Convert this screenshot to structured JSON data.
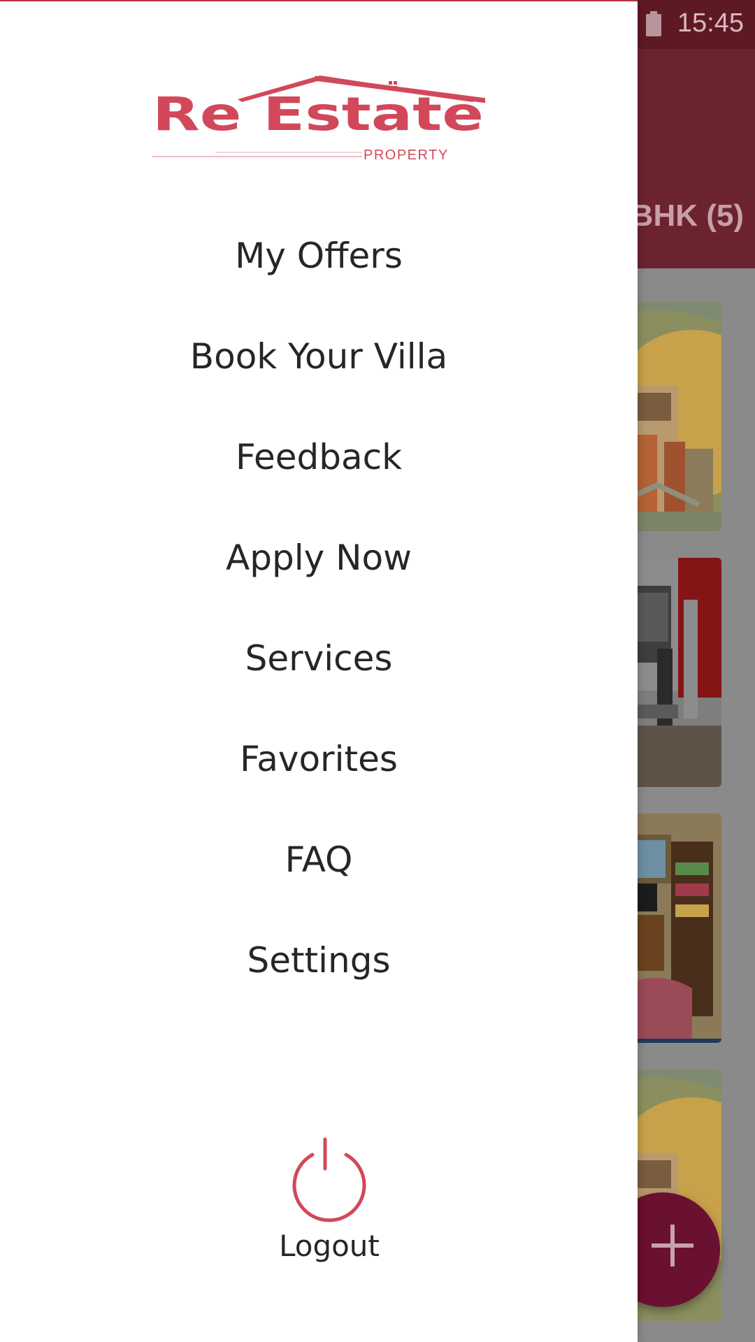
{
  "status_bar": {
    "time": "15:45",
    "battery_icon": "battery-icon"
  },
  "app_bar": {
    "tab_label": "2BHK (5)"
  },
  "drawer": {
    "logo": {
      "name": "Re Estate",
      "tagline": "PROPERTY"
    },
    "menu_items": [
      {
        "label": "My Offers"
      },
      {
        "label": "Book Your Villa"
      },
      {
        "label": "Feedback"
      },
      {
        "label": "Apply Now"
      },
      {
        "label": "Services"
      },
      {
        "label": "Favorites"
      },
      {
        "label": "FAQ"
      },
      {
        "label": "Settings"
      }
    ],
    "logout": {
      "label": "Logout",
      "icon": "power-icon"
    }
  },
  "fab": {
    "icon": "plus-icon"
  },
  "colors": {
    "brand": "#d2485a",
    "app_bar_dimmed": "#6c2330",
    "fab": "#6a1030",
    "menu_text": "#262626"
  }
}
